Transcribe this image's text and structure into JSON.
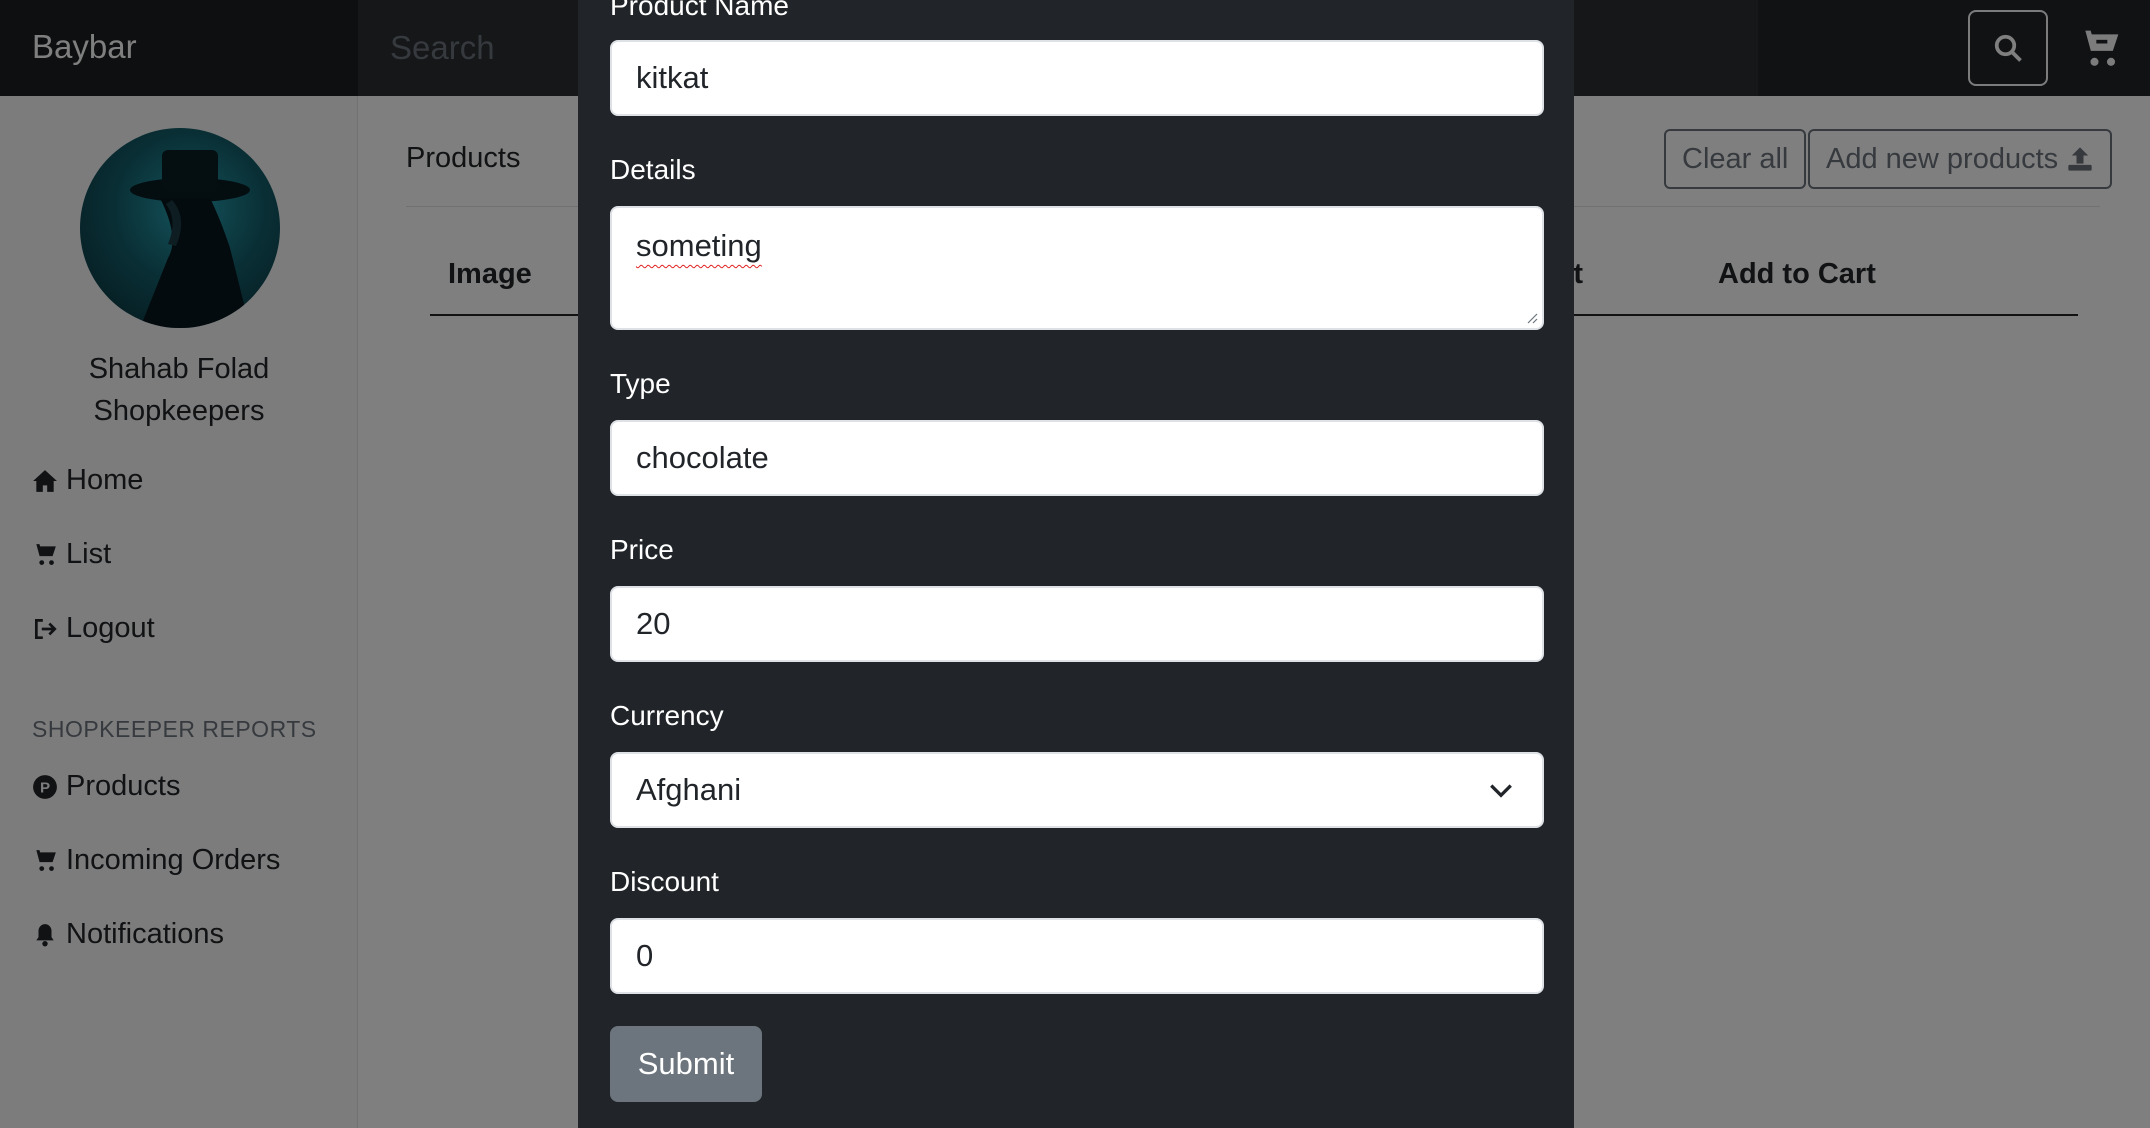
{
  "navbar": {
    "brand": "Baybar",
    "search_placeholder": "Search"
  },
  "sidebar": {
    "user_name": "Shahab Folad",
    "user_role": "Shopkeepers",
    "nav": [
      {
        "label": "Home",
        "icon": "home-icon"
      },
      {
        "label": "List",
        "icon": "cart-icon"
      },
      {
        "label": "Logout",
        "icon": "logout-icon"
      }
    ],
    "section_title": "SHOPKEEPER REPORTS",
    "reports": [
      {
        "label": "Products",
        "icon": "p-circle-icon"
      },
      {
        "label": "Incoming Orders",
        "icon": "cart-icon"
      },
      {
        "label": "Notifications",
        "icon": "bell-icon"
      }
    ]
  },
  "main": {
    "heading": "Products",
    "clear_all_label": "Clear all",
    "add_new_label": "Add new products",
    "columns": [
      "Image",
      "unt",
      "Add to Cart"
    ]
  },
  "modal": {
    "fields": {
      "product_name": {
        "label": "Product Name",
        "value": "kitkat"
      },
      "details": {
        "label": "Details",
        "value": "someting"
      },
      "type": {
        "label": "Type",
        "value": "chocolate"
      },
      "price": {
        "label": "Price",
        "value": "20"
      },
      "currency": {
        "label": "Currency",
        "value": "Afghani"
      },
      "discount": {
        "label": "Discount",
        "value": "0"
      }
    },
    "submit_label": "Submit"
  },
  "colors": {
    "navbar": "#212529",
    "modal_bg": "#212529",
    "submit_bg": "#6c757d",
    "sidebar_bg": "#f8f9fa"
  }
}
